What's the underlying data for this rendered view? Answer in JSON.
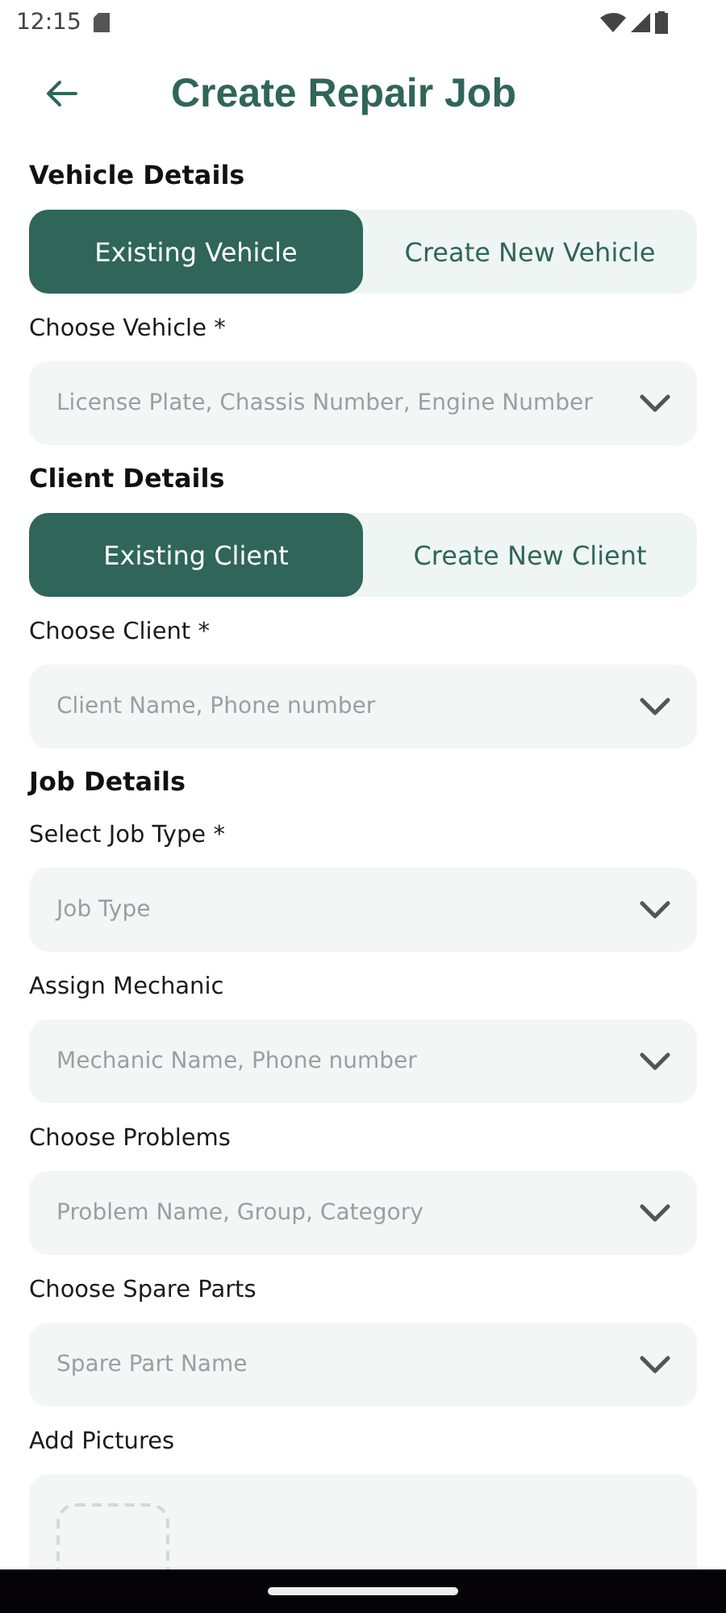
{
  "status_bar": {
    "time": "12:15"
  },
  "header": {
    "title": "Create Repair Job"
  },
  "sections": [
    {
      "title": "Vehicle Details",
      "toggle": [
        {
          "label": "Existing Vehicle",
          "selected": true
        },
        {
          "label": "Create New Vehicle",
          "selected": false
        }
      ],
      "fields": [
        {
          "kind": "dropdown",
          "label": "Choose Vehicle *",
          "placeholder": "License Plate, Chassis Number, Engine Number"
        }
      ]
    },
    {
      "title": "Client Details",
      "toggle": [
        {
          "label": "Existing Client",
          "selected": true
        },
        {
          "label": "Create New Client",
          "selected": false
        }
      ],
      "fields": [
        {
          "kind": "dropdown",
          "label": "Choose Client *",
          "placeholder": "Client Name, Phone number"
        }
      ]
    },
    {
      "title": "Job Details",
      "fields": [
        {
          "kind": "dropdown",
          "label": "Select Job Type *",
          "placeholder": "Job Type"
        },
        {
          "kind": "dropdown",
          "label": "Assign Mechanic",
          "placeholder": "Mechanic Name, Phone number"
        },
        {
          "kind": "dropdown",
          "label": "Choose Problems",
          "placeholder": "Problem Name, Group, Category"
        },
        {
          "kind": "dropdown",
          "label": "Choose Spare Parts",
          "placeholder": "Spare Part Name"
        },
        {
          "kind": "pictures",
          "label": "Add Pictures"
        }
      ]
    }
  ]
}
